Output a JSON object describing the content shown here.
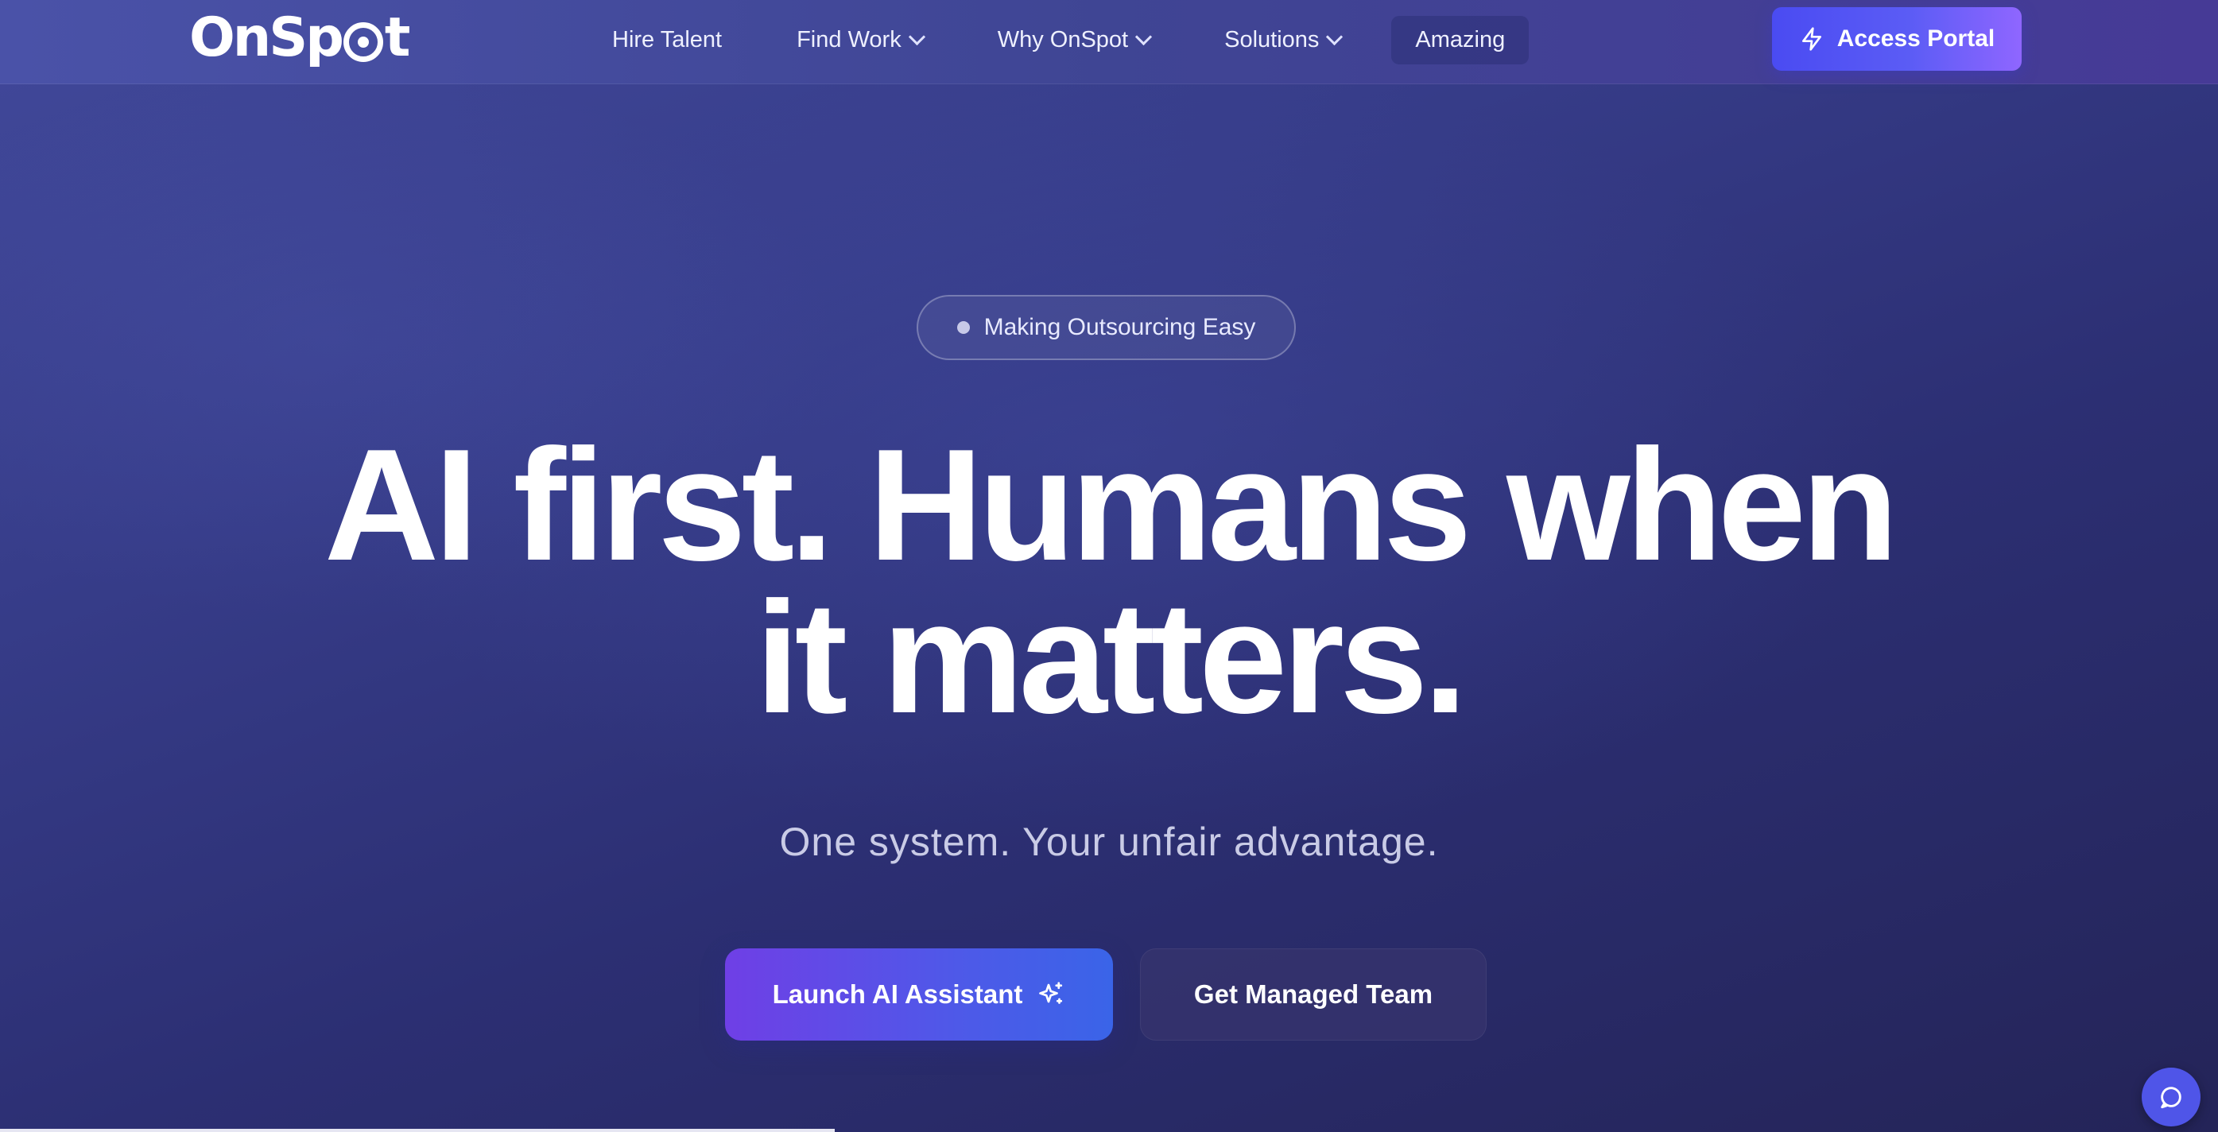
{
  "nav": {
    "logo_text_1": "On",
    "logo_text_2": "Sp",
    "logo_text_3": "t",
    "items": [
      {
        "label": "Hire Talent",
        "has_dropdown": false
      },
      {
        "label": "Find Work",
        "has_dropdown": true
      },
      {
        "label": "Why OnSpot",
        "has_dropdown": true
      },
      {
        "label": "Solutions",
        "has_dropdown": true
      },
      {
        "label": "Amazing",
        "has_dropdown": false
      }
    ],
    "access_button": {
      "label": "Access Portal",
      "icon": "lightning-icon"
    }
  },
  "hero": {
    "badge": "Making Outsourcing Easy",
    "headline_line1": "AI first. Humans when",
    "headline_line2": "it matters.",
    "subheadline": "One system. Your unfair advantage.",
    "primary_button": {
      "label": "Launch AI Assistant",
      "icon": "sparkles-icon"
    },
    "secondary_button": {
      "label": "Get Managed Team"
    }
  },
  "chat_widget": {
    "icon": "chat-bubble-icon"
  },
  "colors": {
    "accent": "#4f55e8",
    "background_top": "#41489a",
    "background_bottom": "#242458"
  }
}
